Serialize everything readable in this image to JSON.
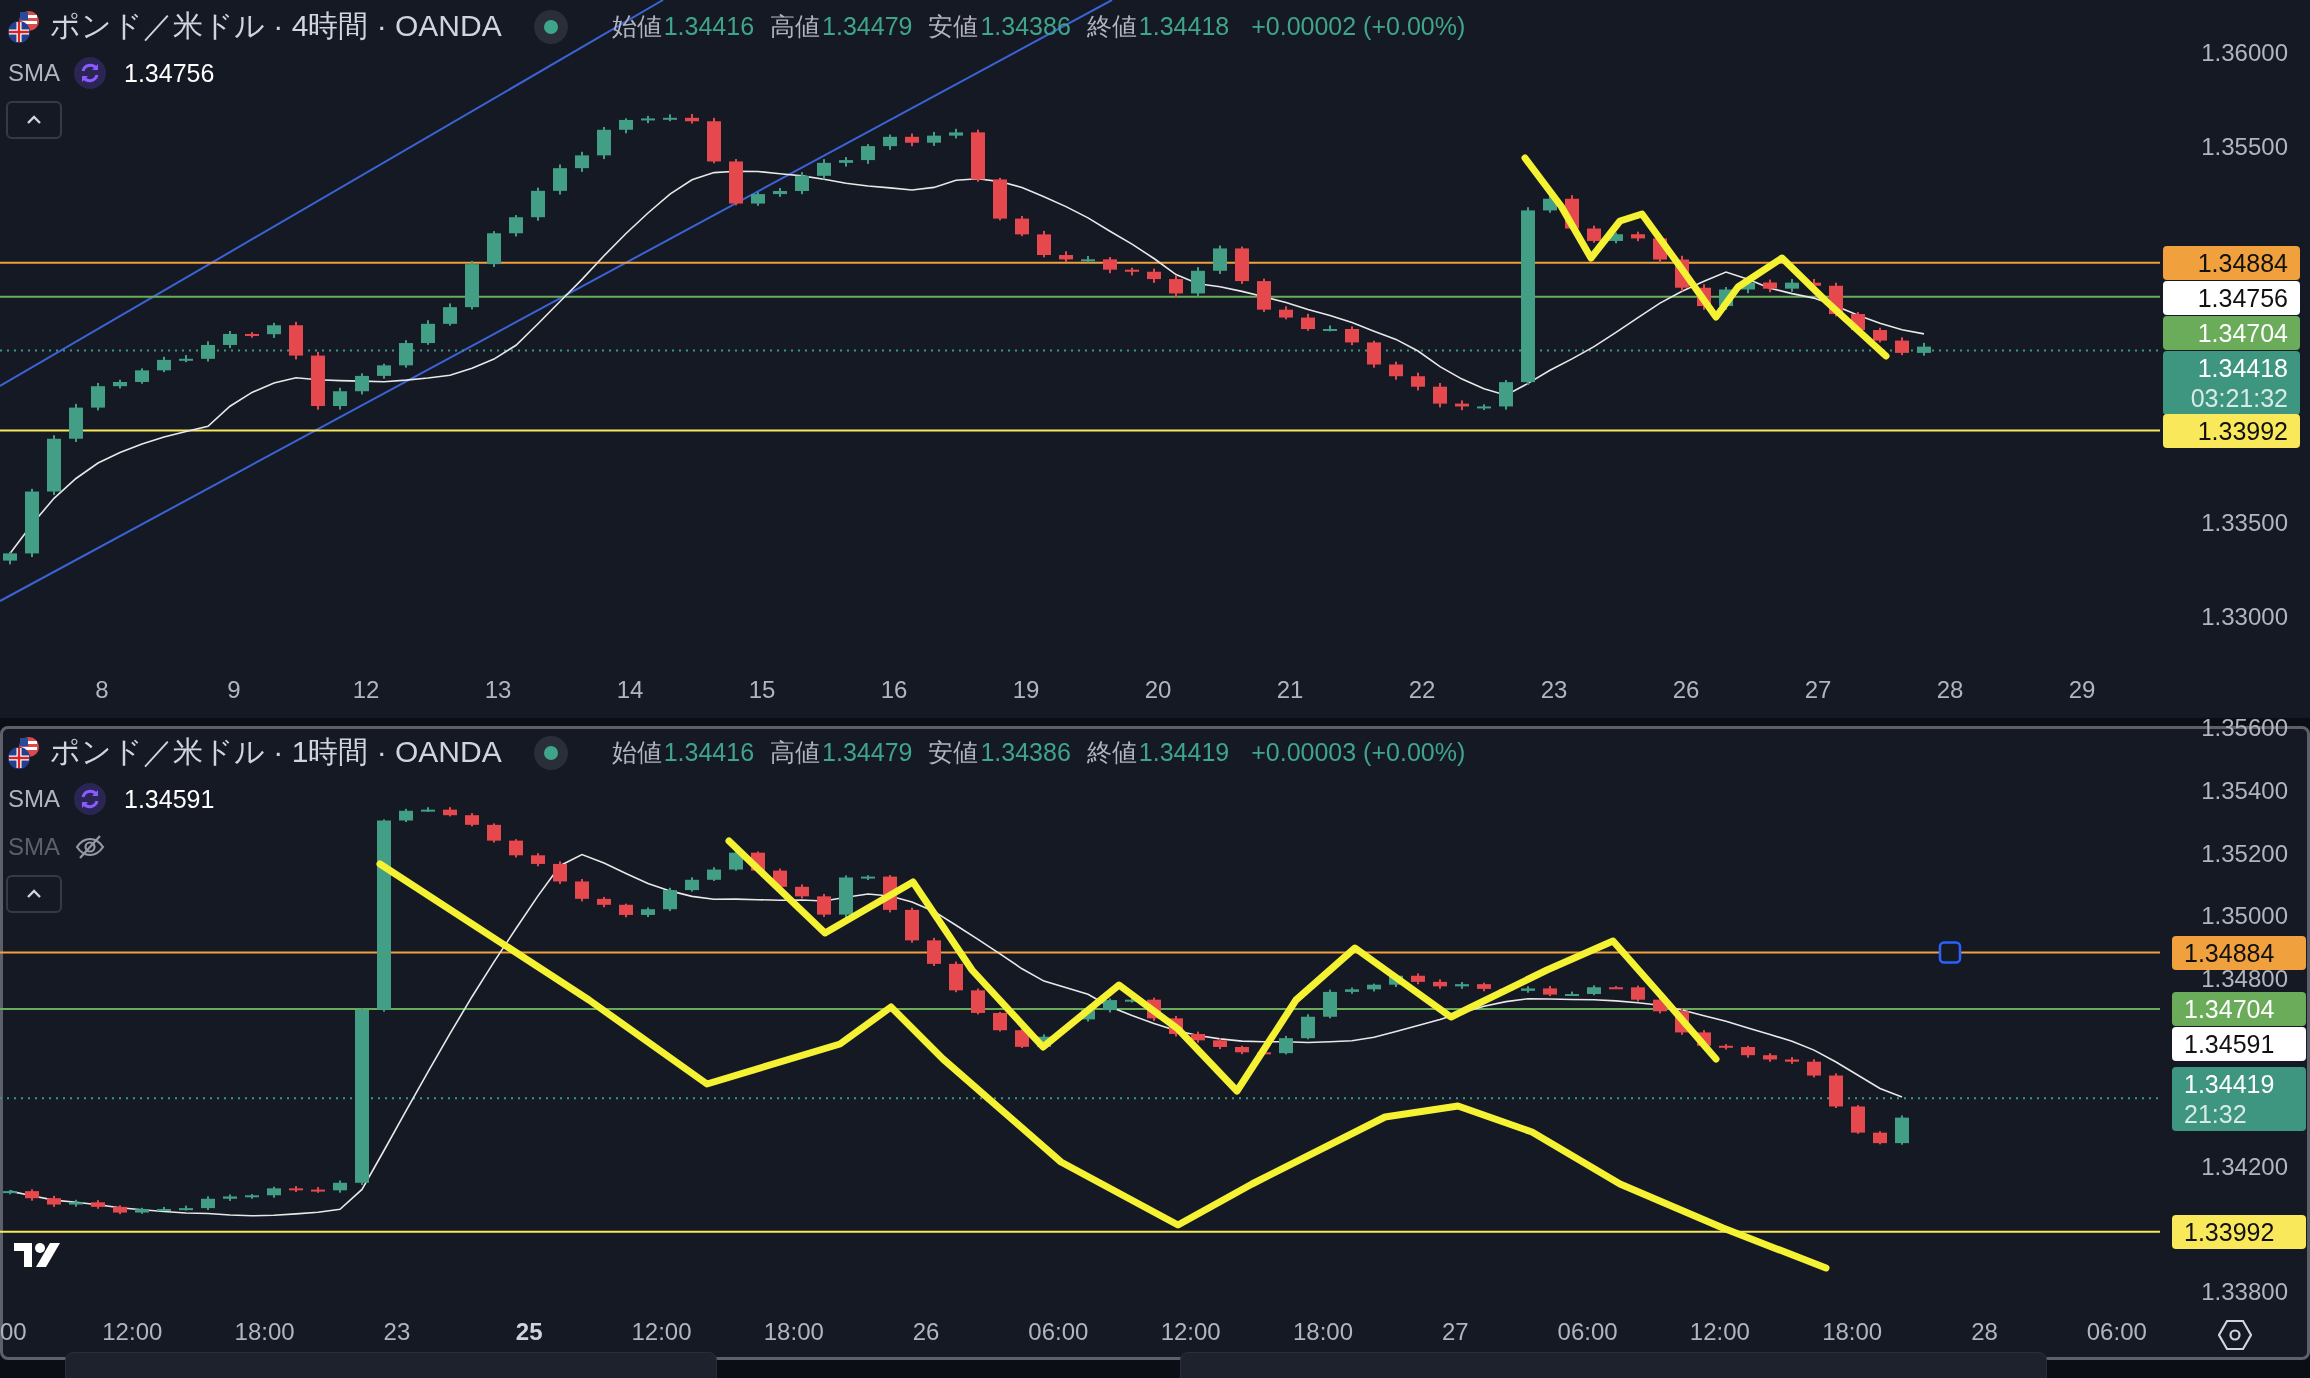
{
  "panes": [
    {
      "title": "ポンド／米ドル · 4時間 · OANDA",
      "selected": false,
      "ohlc": [
        {
          "label": "始値",
          "value": "1.34416"
        },
        {
          "label": "高値",
          "value": "1.34479"
        },
        {
          "label": "安値",
          "value": "1.34386"
        },
        {
          "label": "終値",
          "value": "1.34418"
        }
      ],
      "change": "+0.00002 (+0.00%)",
      "indicators": [
        {
          "label": "SMA",
          "value": "1.34756",
          "visible": true
        }
      ],
      "price_ticks": [
        "1.36000",
        "1.35500",
        "1.33500",
        "1.33000"
      ],
      "price_tags": [
        {
          "kind": "level",
          "price": "1.34884",
          "color": "#f0a03c"
        },
        {
          "kind": "indicator",
          "price": "1.34756",
          "color": "#ffffff"
        },
        {
          "kind": "level",
          "price": "1.34704",
          "color": "#6aac5a"
        },
        {
          "kind": "last",
          "price": "1.34418",
          "countdown": "03:21:32",
          "color": "#3f9680"
        },
        {
          "kind": "level",
          "price": "1.33992",
          "color": "#f8e85a"
        }
      ],
      "line_handle": false,
      "time_labels": [
        {
          "label": "8",
          "bold": false
        },
        {
          "label": "9",
          "bold": false
        },
        {
          "label": "12",
          "bold": false
        },
        {
          "label": "13",
          "bold": false
        },
        {
          "label": "14",
          "bold": false
        },
        {
          "label": "15",
          "bold": false
        },
        {
          "label": "16",
          "bold": false
        },
        {
          "label": "19",
          "bold": false
        },
        {
          "label": "20",
          "bold": false
        },
        {
          "label": "21",
          "bold": false
        },
        {
          "label": "22",
          "bold": false
        },
        {
          "label": "23",
          "bold": false
        },
        {
          "label": "26",
          "bold": false
        },
        {
          "label": "27",
          "bold": false
        },
        {
          "label": "28",
          "bold": false
        },
        {
          "label": "29",
          "bold": false
        }
      ]
    },
    {
      "title": "ポンド／米ドル · 1時間 · OANDA",
      "selected": true,
      "ohlc": [
        {
          "label": "始値",
          "value": "1.34416"
        },
        {
          "label": "高値",
          "value": "1.34479"
        },
        {
          "label": "安値",
          "value": "1.34386"
        },
        {
          "label": "終値",
          "value": "1.34419"
        }
      ],
      "change": "+0.00003 (+0.00%)",
      "indicators": [
        {
          "label": "SMA",
          "value": "1.34591",
          "visible": true
        },
        {
          "label": "SMA",
          "visible": false
        }
      ],
      "price_ticks": [
        "1.35600",
        "1.35400",
        "1.35200",
        "1.35000",
        "1.34800",
        "1.34200",
        "1.33800"
      ],
      "price_tags": [
        {
          "kind": "level",
          "price": "1.34884",
          "color": "#f0a03c"
        },
        {
          "kind": "level",
          "price": "1.34704",
          "color": "#6aac5a"
        },
        {
          "kind": "indicator",
          "price": "1.34591",
          "color": "#ffffff"
        },
        {
          "kind": "last",
          "price": "1.34419",
          "countdown": "21:32",
          "color": "#3f9680"
        },
        {
          "kind": "level",
          "price": "1.33992",
          "color": "#f8e85a"
        }
      ],
      "line_handle": true,
      "time_labels": [
        {
          "label": "00",
          "bold": false
        },
        {
          "label": "12:00",
          "bold": false
        },
        {
          "label": "18:00",
          "bold": false
        },
        {
          "label": "23",
          "bold": false
        },
        {
          "label": "25",
          "bold": true
        },
        {
          "label": "12:00",
          "bold": false
        },
        {
          "label": "18:00",
          "bold": false
        },
        {
          "label": "26",
          "bold": false
        },
        {
          "label": "06:00",
          "bold": false
        },
        {
          "label": "12:00",
          "bold": false
        },
        {
          "label": "18:00",
          "bold": false
        },
        {
          "label": "27",
          "bold": false
        },
        {
          "label": "06:00",
          "bold": false
        },
        {
          "label": "12:00",
          "bold": false
        },
        {
          "label": "18:00",
          "bold": false
        },
        {
          "label": "28",
          "bold": false
        },
        {
          "label": "06:00",
          "bold": false
        }
      ]
    }
  ]
}
